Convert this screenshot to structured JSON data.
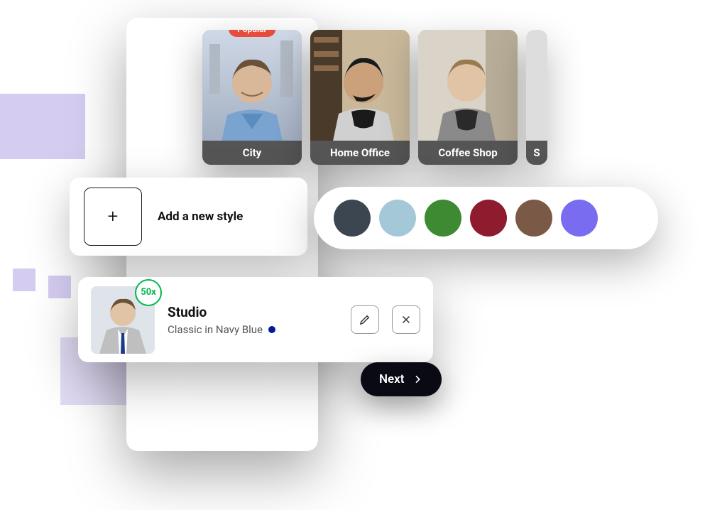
{
  "styles": [
    {
      "label": "City",
      "popular": true
    },
    {
      "label": "Home Office",
      "popular": false
    },
    {
      "label": "Coffee Shop",
      "popular": false
    },
    {
      "label": "S",
      "popular": false
    }
  ],
  "popular_badge": "Popular",
  "add_style_label": "Add a new style",
  "colors": [
    "#3b4651",
    "#a5c8d9",
    "#3d8a32",
    "#8e1c2e",
    "#7a5a46",
    "#7a6cf0"
  ],
  "selected": {
    "count_badge": "50x",
    "title": "Studio",
    "subtitle": "Classic in Navy Blue"
  },
  "next_label": "Next"
}
